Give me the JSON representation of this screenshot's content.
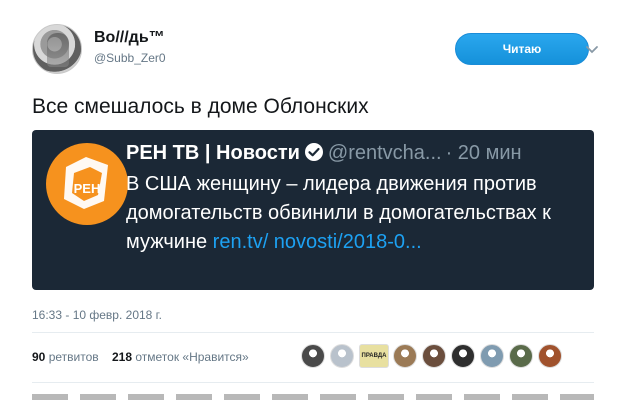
{
  "author": {
    "display_name": "Во///дь™",
    "handle": "@Subb_Zer0"
  },
  "follow_button": {
    "label": "Читаю"
  },
  "tweet": {
    "text": "Все смешалось в доме Облонских",
    "timestamp": "16:33 - 10 февр. 2018 г."
  },
  "quoted": {
    "name": "РЕН ТВ | Новости",
    "handle": "@rentvcha...",
    "time": "· 20 мин",
    "body": "В США женщину – лидера движения против домогательств обвинили в домогательствах к мужчине ",
    "link": "ren.tv/ novosti/2018-0...",
    "logo_color": "#f6921e",
    "logo_text": "РЕН"
  },
  "stats": {
    "retweets_count": "90",
    "retweets_label": "ретвитов",
    "likes_count": "218",
    "likes_label": "отметок «Нравится»"
  },
  "likers": [
    {
      "icon": "avatar-1",
      "color": "#4a4a4a"
    },
    {
      "icon": "avatar-2",
      "color": "#b9c2cc"
    },
    {
      "icon": "avatar-3-pravda",
      "color": "#e8e0a0",
      "text": "ПРАВДА"
    },
    {
      "icon": "avatar-4",
      "color": "#9b7a56"
    },
    {
      "icon": "avatar-5",
      "color": "#6b4e3d"
    },
    {
      "icon": "avatar-6",
      "color": "#2e2e2e"
    },
    {
      "icon": "avatar-7",
      "color": "#7f9bb0"
    },
    {
      "icon": "avatar-8",
      "color": "#5a6b4a"
    },
    {
      "icon": "avatar-9",
      "color": "#a0522d"
    }
  ],
  "colors": {
    "accent": "#1da1f2",
    "quote_bg": "#1b2836",
    "muted": "#657786"
  }
}
